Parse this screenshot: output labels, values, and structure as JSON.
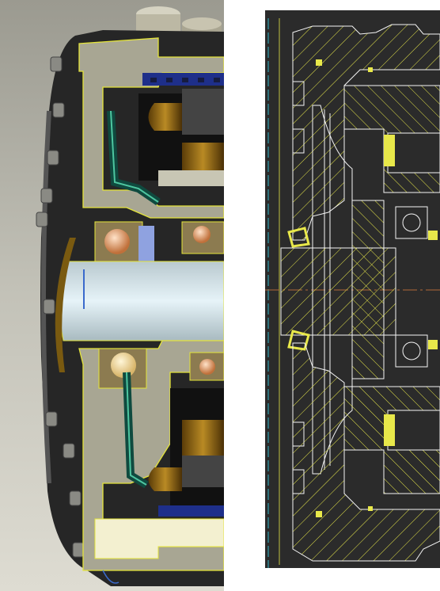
{
  "panels": {
    "render": {
      "view": "3d-cutaway",
      "background": [
        "#9b9a90",
        "#dcdbd2"
      ]
    },
    "drawing": {
      "view": "2d-section",
      "background": "#2b2b2b",
      "line_color": "#f4f4f4",
      "hatch_color": "#e8e84a",
      "centerline_color": "#b06a3a",
      "border_color": "#31b6c8"
    }
  }
}
